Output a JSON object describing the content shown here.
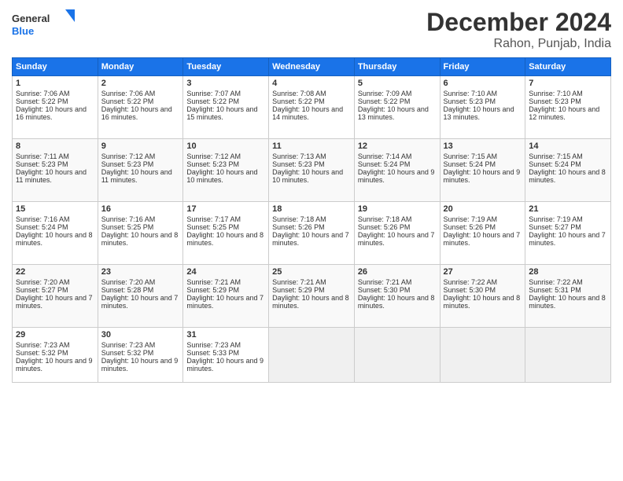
{
  "logo": {
    "line1": "General",
    "line2": "Blue"
  },
  "title": "December 2024",
  "location": "Rahon, Punjab, India",
  "days_header": [
    "Sunday",
    "Monday",
    "Tuesday",
    "Wednesday",
    "Thursday",
    "Friday",
    "Saturday"
  ],
  "weeks": [
    [
      {
        "day": "1",
        "sunrise": "Sunrise: 7:06 AM",
        "sunset": "Sunset: 5:22 PM",
        "daylight": "Daylight: 10 hours and 16 minutes."
      },
      {
        "day": "2",
        "sunrise": "Sunrise: 7:06 AM",
        "sunset": "Sunset: 5:22 PM",
        "daylight": "Daylight: 10 hours and 16 minutes."
      },
      {
        "day": "3",
        "sunrise": "Sunrise: 7:07 AM",
        "sunset": "Sunset: 5:22 PM",
        "daylight": "Daylight: 10 hours and 15 minutes."
      },
      {
        "day": "4",
        "sunrise": "Sunrise: 7:08 AM",
        "sunset": "Sunset: 5:22 PM",
        "daylight": "Daylight: 10 hours and 14 minutes."
      },
      {
        "day": "5",
        "sunrise": "Sunrise: 7:09 AM",
        "sunset": "Sunset: 5:22 PM",
        "daylight": "Daylight: 10 hours and 13 minutes."
      },
      {
        "day": "6",
        "sunrise": "Sunrise: 7:10 AM",
        "sunset": "Sunset: 5:23 PM",
        "daylight": "Daylight: 10 hours and 13 minutes."
      },
      {
        "day": "7",
        "sunrise": "Sunrise: 7:10 AM",
        "sunset": "Sunset: 5:23 PM",
        "daylight": "Daylight: 10 hours and 12 minutes."
      }
    ],
    [
      {
        "day": "8",
        "sunrise": "Sunrise: 7:11 AM",
        "sunset": "Sunset: 5:23 PM",
        "daylight": "Daylight: 10 hours and 11 minutes."
      },
      {
        "day": "9",
        "sunrise": "Sunrise: 7:12 AM",
        "sunset": "Sunset: 5:23 PM",
        "daylight": "Daylight: 10 hours and 11 minutes."
      },
      {
        "day": "10",
        "sunrise": "Sunrise: 7:12 AM",
        "sunset": "Sunset: 5:23 PM",
        "daylight": "Daylight: 10 hours and 10 minutes."
      },
      {
        "day": "11",
        "sunrise": "Sunrise: 7:13 AM",
        "sunset": "Sunset: 5:23 PM",
        "daylight": "Daylight: 10 hours and 10 minutes."
      },
      {
        "day": "12",
        "sunrise": "Sunrise: 7:14 AM",
        "sunset": "Sunset: 5:24 PM",
        "daylight": "Daylight: 10 hours and 9 minutes."
      },
      {
        "day": "13",
        "sunrise": "Sunrise: 7:15 AM",
        "sunset": "Sunset: 5:24 PM",
        "daylight": "Daylight: 10 hours and 9 minutes."
      },
      {
        "day": "14",
        "sunrise": "Sunrise: 7:15 AM",
        "sunset": "Sunset: 5:24 PM",
        "daylight": "Daylight: 10 hours and 8 minutes."
      }
    ],
    [
      {
        "day": "15",
        "sunrise": "Sunrise: 7:16 AM",
        "sunset": "Sunset: 5:24 PM",
        "daylight": "Daylight: 10 hours and 8 minutes."
      },
      {
        "day": "16",
        "sunrise": "Sunrise: 7:16 AM",
        "sunset": "Sunset: 5:25 PM",
        "daylight": "Daylight: 10 hours and 8 minutes."
      },
      {
        "day": "17",
        "sunrise": "Sunrise: 7:17 AM",
        "sunset": "Sunset: 5:25 PM",
        "daylight": "Daylight: 10 hours and 8 minutes."
      },
      {
        "day": "18",
        "sunrise": "Sunrise: 7:18 AM",
        "sunset": "Sunset: 5:26 PM",
        "daylight": "Daylight: 10 hours and 7 minutes."
      },
      {
        "day": "19",
        "sunrise": "Sunrise: 7:18 AM",
        "sunset": "Sunset: 5:26 PM",
        "daylight": "Daylight: 10 hours and 7 minutes."
      },
      {
        "day": "20",
        "sunrise": "Sunrise: 7:19 AM",
        "sunset": "Sunset: 5:26 PM",
        "daylight": "Daylight: 10 hours and 7 minutes."
      },
      {
        "day": "21",
        "sunrise": "Sunrise: 7:19 AM",
        "sunset": "Sunset: 5:27 PM",
        "daylight": "Daylight: 10 hours and 7 minutes."
      }
    ],
    [
      {
        "day": "22",
        "sunrise": "Sunrise: 7:20 AM",
        "sunset": "Sunset: 5:27 PM",
        "daylight": "Daylight: 10 hours and 7 minutes."
      },
      {
        "day": "23",
        "sunrise": "Sunrise: 7:20 AM",
        "sunset": "Sunset: 5:28 PM",
        "daylight": "Daylight: 10 hours and 7 minutes."
      },
      {
        "day": "24",
        "sunrise": "Sunrise: 7:21 AM",
        "sunset": "Sunset: 5:29 PM",
        "daylight": "Daylight: 10 hours and 7 minutes."
      },
      {
        "day": "25",
        "sunrise": "Sunrise: 7:21 AM",
        "sunset": "Sunset: 5:29 PM",
        "daylight": "Daylight: 10 hours and 8 minutes."
      },
      {
        "day": "26",
        "sunrise": "Sunrise: 7:21 AM",
        "sunset": "Sunset: 5:30 PM",
        "daylight": "Daylight: 10 hours and 8 minutes."
      },
      {
        "day": "27",
        "sunrise": "Sunrise: 7:22 AM",
        "sunset": "Sunset: 5:30 PM",
        "daylight": "Daylight: 10 hours and 8 minutes."
      },
      {
        "day": "28",
        "sunrise": "Sunrise: 7:22 AM",
        "sunset": "Sunset: 5:31 PM",
        "daylight": "Daylight: 10 hours and 8 minutes."
      }
    ],
    [
      {
        "day": "29",
        "sunrise": "Sunrise: 7:23 AM",
        "sunset": "Sunset: 5:32 PM",
        "daylight": "Daylight: 10 hours and 9 minutes."
      },
      {
        "day": "30",
        "sunrise": "Sunrise: 7:23 AM",
        "sunset": "Sunset: 5:32 PM",
        "daylight": "Daylight: 10 hours and 9 minutes."
      },
      {
        "day": "31",
        "sunrise": "Sunrise: 7:23 AM",
        "sunset": "Sunset: 5:33 PM",
        "daylight": "Daylight: 10 hours and 9 minutes."
      },
      null,
      null,
      null,
      null
    ]
  ]
}
